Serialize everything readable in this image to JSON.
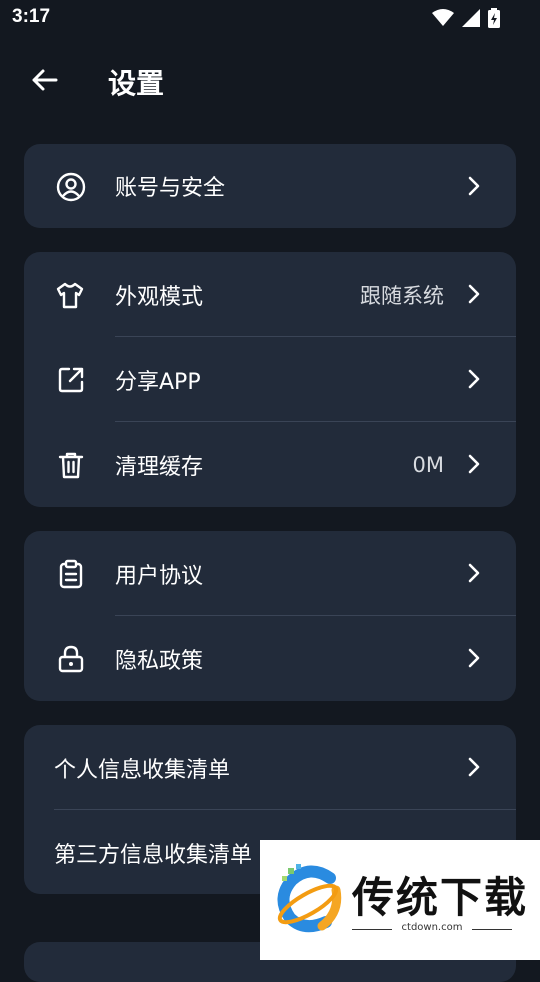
{
  "status": {
    "time": "3:17"
  },
  "header": {
    "title": "设置"
  },
  "groups": [
    {
      "items": [
        {
          "label": "账号与安全",
          "icon": "user-circle-icon"
        }
      ]
    },
    {
      "items": [
        {
          "label": "外观模式",
          "value": "跟随系统",
          "icon": "tshirt-icon"
        },
        {
          "label": "分享APP",
          "icon": "share-icon"
        },
        {
          "label": "清理缓存",
          "value": "0M",
          "icon": "trash-icon"
        }
      ]
    },
    {
      "items": [
        {
          "label": "用户协议",
          "icon": "clipboard-icon"
        },
        {
          "label": "隐私政策",
          "icon": "lock-icon"
        }
      ]
    },
    {
      "items": [
        {
          "label": "个人信息收集清单"
        },
        {
          "label": "第三方信息收集清单"
        }
      ]
    }
  ],
  "watermark": {
    "brand": "传统下载",
    "url": "ctdown.com"
  }
}
